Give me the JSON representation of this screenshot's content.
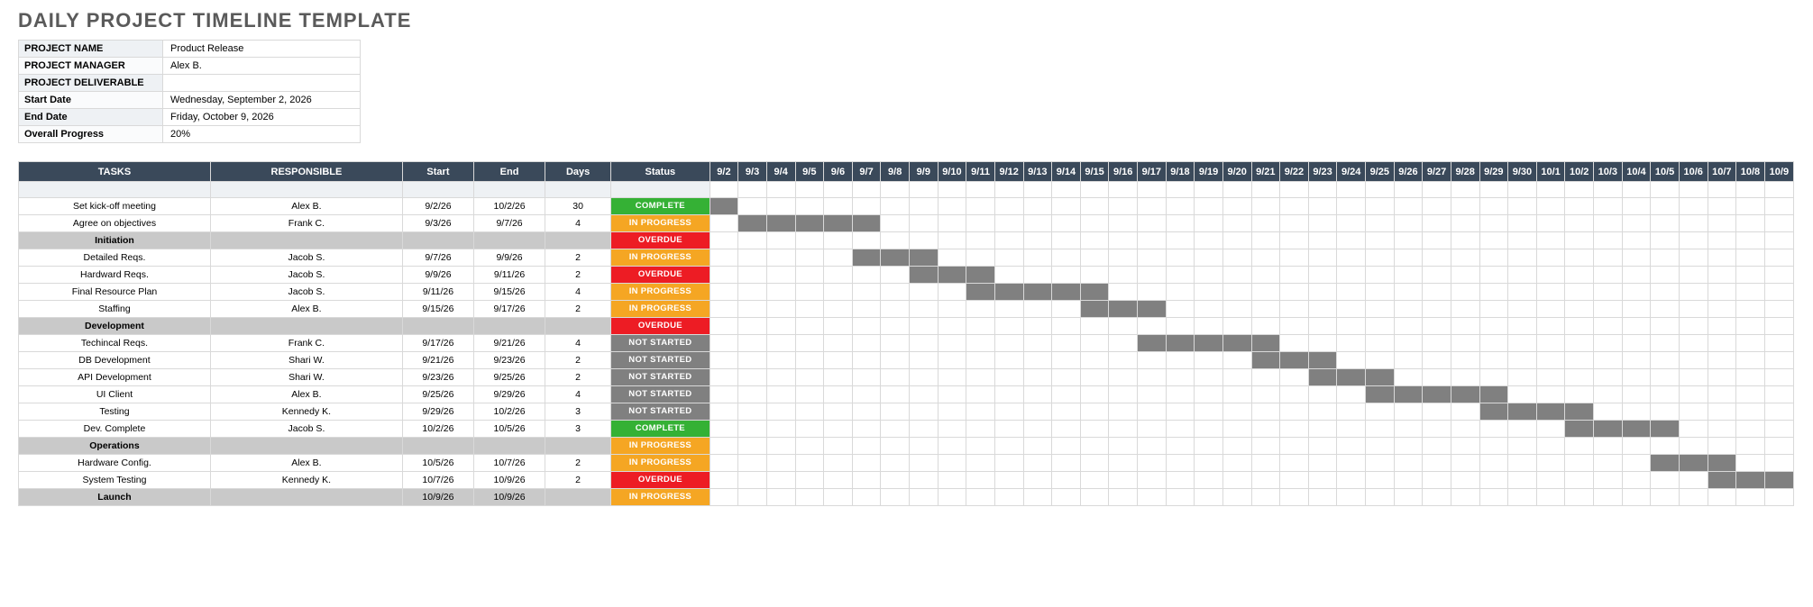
{
  "title": "DAILY PROJECT TIMELINE TEMPLATE",
  "meta": [
    {
      "label": "PROJECT NAME",
      "value": "Product Release"
    },
    {
      "label": "PROJECT MANAGER",
      "value": "Alex B."
    },
    {
      "label": "PROJECT DELIVERABLE",
      "value": ""
    },
    {
      "label": "Start Date",
      "value": "Wednesday, September 2, 2026"
    },
    {
      "label": "End Date",
      "value": "Friday, October 9, 2026"
    },
    {
      "label": "Overall Progress",
      "value": "20%"
    }
  ],
  "headers": {
    "tasks": "TASKS",
    "responsible": "RESPONSIBLE",
    "start": "Start",
    "end": "End",
    "days": "Days",
    "status": "Status"
  },
  "timeline_start": {
    "month": 9,
    "day": 2
  },
  "timeline_days": 38,
  "status_labels": {
    "COMPLETE": "COMPLETE",
    "IN_PROGRESS": "IN PROGRESS",
    "OVERDUE": "OVERDUE",
    "NOT_STARTED": "NOT STARTED"
  },
  "rows": [
    {
      "type": "spacer"
    },
    {
      "type": "task",
      "name": "Set kick-off meeting",
      "resp": "Alex B.",
      "start": "9/2/26",
      "end": "10/2/26",
      "days": "30",
      "status": "COMPLETE",
      "bar_start": 0,
      "bar_len": 1
    },
    {
      "type": "task",
      "name": "Agree on objectives",
      "resp": "Frank C.",
      "start": "9/3/26",
      "end": "9/7/26",
      "days": "4",
      "status": "IN_PROGRESS",
      "bar_start": 1,
      "bar_len": 5
    },
    {
      "type": "section",
      "name": "Initiation",
      "status": "OVERDUE"
    },
    {
      "type": "task",
      "name": "Detailed Reqs.",
      "resp": "Jacob S.",
      "start": "9/7/26",
      "end": "9/9/26",
      "days": "2",
      "status": "IN_PROGRESS",
      "bar_start": 5,
      "bar_len": 3
    },
    {
      "type": "task",
      "name": "Hardward Reqs.",
      "resp": "Jacob S.",
      "start": "9/9/26",
      "end": "9/11/26",
      "days": "2",
      "status": "OVERDUE",
      "bar_start": 7,
      "bar_len": 3
    },
    {
      "type": "task",
      "name": "Final Resource Plan",
      "resp": "Jacob S.",
      "start": "9/11/26",
      "end": "9/15/26",
      "days": "4",
      "status": "IN_PROGRESS",
      "bar_start": 9,
      "bar_len": 5
    },
    {
      "type": "task",
      "name": "Staffing",
      "resp": "Alex B.",
      "start": "9/15/26",
      "end": "9/17/26",
      "days": "2",
      "status": "IN_PROGRESS",
      "bar_start": 13,
      "bar_len": 3
    },
    {
      "type": "section",
      "name": "Development",
      "status": "OVERDUE"
    },
    {
      "type": "task",
      "name": "Techincal Reqs.",
      "resp": "Frank C.",
      "start": "9/17/26",
      "end": "9/21/26",
      "days": "4",
      "status": "NOT_STARTED",
      "bar_start": 15,
      "bar_len": 5
    },
    {
      "type": "task",
      "name": "DB Development",
      "resp": "Shari W.",
      "start": "9/21/26",
      "end": "9/23/26",
      "days": "2",
      "status": "NOT_STARTED",
      "bar_start": 19,
      "bar_len": 3
    },
    {
      "type": "task",
      "name": "API Development",
      "resp": "Shari W.",
      "start": "9/23/26",
      "end": "9/25/26",
      "days": "2",
      "status": "NOT_STARTED",
      "bar_start": 21,
      "bar_len": 3
    },
    {
      "type": "task",
      "name": "UI Client",
      "resp": "Alex B.",
      "start": "9/25/26",
      "end": "9/29/26",
      "days": "4",
      "status": "NOT_STARTED",
      "bar_start": 23,
      "bar_len": 5
    },
    {
      "type": "task",
      "name": "Testing",
      "resp": "Kennedy K.",
      "start": "9/29/26",
      "end": "10/2/26",
      "days": "3",
      "status": "NOT_STARTED",
      "bar_start": 27,
      "bar_len": 4
    },
    {
      "type": "task",
      "name": "Dev. Complete",
      "resp": "Jacob S.",
      "start": "10/2/26",
      "end": "10/5/26",
      "days": "3",
      "status": "COMPLETE",
      "bar_start": 30,
      "bar_len": 4
    },
    {
      "type": "section",
      "name": "Operations",
      "status": "IN_PROGRESS"
    },
    {
      "type": "task",
      "name": "Hardware Config.",
      "resp": "Alex B.",
      "start": "10/5/26",
      "end": "10/7/26",
      "days": "2",
      "status": "IN_PROGRESS",
      "bar_start": 33,
      "bar_len": 3
    },
    {
      "type": "task",
      "name": "System Testing",
      "resp": "Kennedy K.",
      "start": "10/7/26",
      "end": "10/9/26",
      "days": "2",
      "status": "OVERDUE",
      "bar_start": 35,
      "bar_len": 3
    },
    {
      "type": "section",
      "name": "Launch",
      "start": "10/9/26",
      "end": "10/9/26",
      "status": "IN_PROGRESS"
    }
  ]
}
